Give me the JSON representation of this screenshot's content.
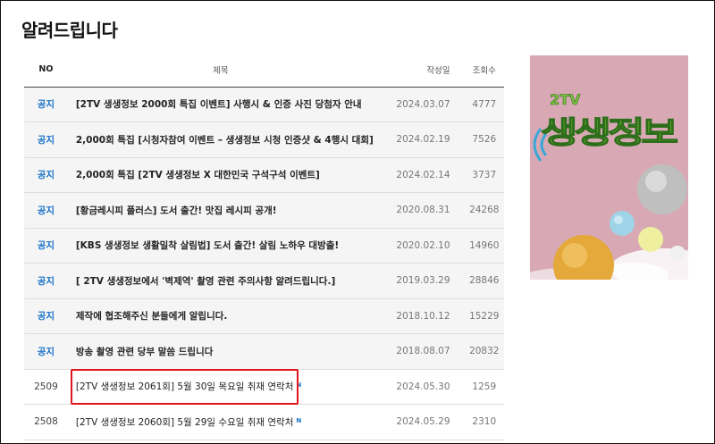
{
  "page": {
    "title": "알려드립니다"
  },
  "table": {
    "headers": {
      "no": "NO",
      "title": "제목",
      "date": "작성일",
      "views": "조회수"
    },
    "rows": [
      {
        "no": "공지",
        "title": "[2TV 생생정보 2000회 특집 이벤트] 사행시 & 인증 사진 당첨자 안내",
        "date": "2024.03.07",
        "views": "4777",
        "notice": true,
        "new": false
      },
      {
        "no": "공지",
        "title": "2,000회 특집 [시청자참여 이벤트 – 생생정보 시청 인증샷 & 4행시 대회]",
        "date": "2024.02.19",
        "views": "7526",
        "notice": true,
        "new": false
      },
      {
        "no": "공지",
        "title": "2,000회 특집 [2TV 생생정보 X 대한민국 구석구석 이벤트]",
        "date": "2024.02.14",
        "views": "3737",
        "notice": true,
        "new": false
      },
      {
        "no": "공지",
        "title": "[황금레시피 플러스] 도서 출간! 맛집 레시피 공개!",
        "date": "2020.08.31",
        "views": "24268",
        "notice": true,
        "new": false
      },
      {
        "no": "공지",
        "title": "[KBS 생생정보 생활밀착 살림법] 도서 출간! 살림 노하우 대방출!",
        "date": "2020.02.10",
        "views": "14960",
        "notice": true,
        "new": false
      },
      {
        "no": "공지",
        "title": "[ 2TV 생생정보에서 '벽제역' 촬영 관련 주의사항 알려드립니다.]",
        "date": "2019.03.29",
        "views": "28846",
        "notice": true,
        "new": false
      },
      {
        "no": "공지",
        "title": "제작에 협조해주신 분들에게 알립니다.",
        "date": "2018.10.12",
        "views": "15229",
        "notice": true,
        "new": false
      },
      {
        "no": "공지",
        "title": "방송 촬영 관련 당부 말씀 드립니다",
        "date": "2018.08.07",
        "views": "20832",
        "notice": true,
        "new": false
      },
      {
        "no": "2509",
        "title": "[2TV 생생정보 2061회] 5월 30일 목요일 취재 연락처",
        "date": "2024.05.30",
        "views": "1259",
        "notice": false,
        "new": true
      },
      {
        "no": "2508",
        "title": "[2TV 생생정보 2060회] 5월 29일 수요일 취재 연락처",
        "date": "2024.05.29",
        "views": "2310",
        "notice": false,
        "new": true
      }
    ],
    "new_badge": "N"
  },
  "ad": {
    "logo_top": "2TV",
    "logo_main": "생생정보",
    "background": "#d8a9b5",
    "accent": "#7fc241"
  },
  "colors": {
    "notice_blue": "#1a73c8",
    "highlight_red": "#e0161d"
  }
}
